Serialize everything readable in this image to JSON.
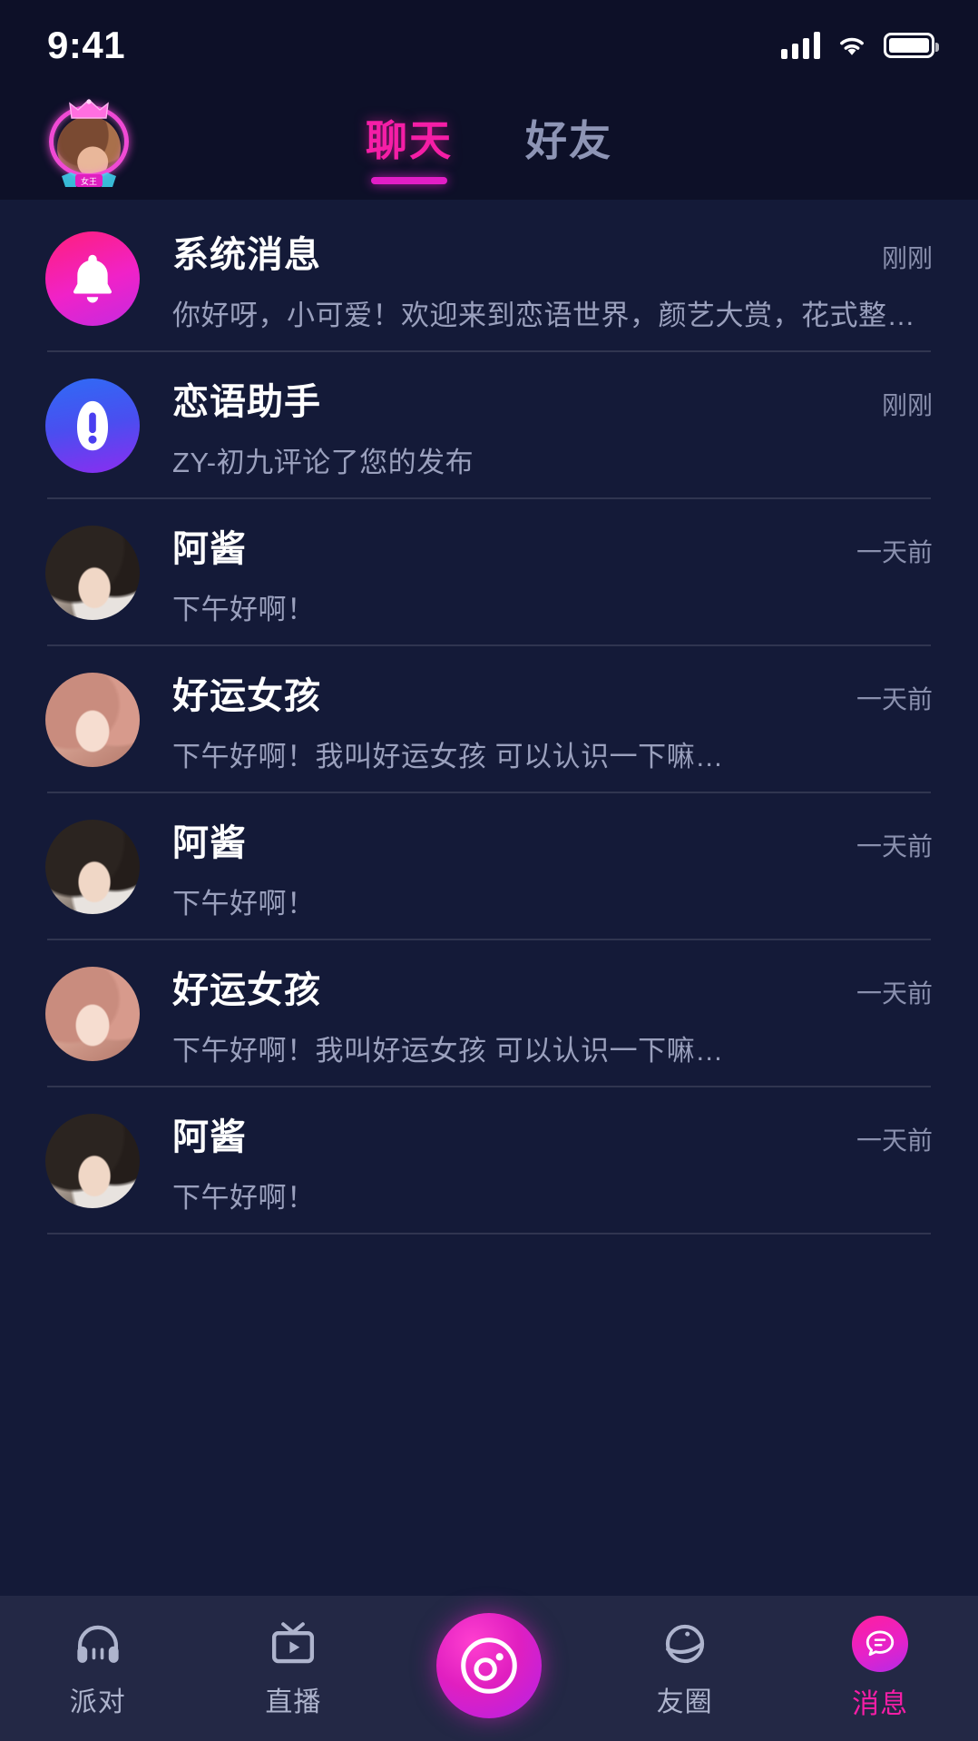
{
  "status_bar": {
    "time": "9:41",
    "signal_icon": "cellular-signal-icon",
    "wifi_icon": "wifi-icon",
    "battery_icon": "battery-icon"
  },
  "header": {
    "avatar_name": "profile-avatar-crowned",
    "tabs": [
      {
        "label": "聊天",
        "active": true
      },
      {
        "label": "好友",
        "active": false
      }
    ]
  },
  "chat_list": [
    {
      "name": "系统消息",
      "time": "刚刚",
      "preview": "你好呀，小可爱！欢迎来到恋语世界，颜艺大赏，花式整蛊…",
      "avatar_kind": "bell-icon"
    },
    {
      "name": "恋语助手",
      "time": "刚刚",
      "preview": "ZY-初九评论了您的发布",
      "avatar_kind": "exclamation-icon"
    },
    {
      "name": "阿酱",
      "time": "一天前",
      "preview": "下午好啊！",
      "avatar_kind": "photo-a"
    },
    {
      "name": "好运女孩",
      "time": "一天前",
      "preview": "下午好啊！我叫好运女孩  可以认识一下嘛…",
      "avatar_kind": "photo-b"
    },
    {
      "name": "阿酱",
      "time": "一天前",
      "preview": "下午好啊！",
      "avatar_kind": "photo-a"
    },
    {
      "name": "好运女孩",
      "time": "一天前",
      "preview": "下午好啊！我叫好运女孩  可以认识一下嘛…",
      "avatar_kind": "photo-b"
    },
    {
      "name": "阿酱",
      "time": "一天前",
      "preview": "下午好啊！",
      "avatar_kind": "photo-a"
    }
  ],
  "bottom_nav": {
    "items": [
      {
        "label": "派对",
        "icon": "headphones-icon",
        "active": false
      },
      {
        "label": "直播",
        "icon": "tv-play-icon",
        "active": false
      },
      {
        "label": "",
        "icon": "camera-record-icon",
        "active": false,
        "center": true
      },
      {
        "label": "友圈",
        "icon": "planet-icon",
        "active": false
      },
      {
        "label": "消息",
        "icon": "message-bubble-icon",
        "active": true
      }
    ]
  },
  "colors": {
    "background": "#141a38",
    "status_bar_bg": "#0d1028",
    "accent_pink": "#f51ea6",
    "tab_underline": "#e21ec6",
    "nav_bg": "#232845",
    "text_primary": "#ffffff",
    "text_secondary": "#9aa0bd",
    "divider": "rgba(255,255,255,0.12)"
  }
}
